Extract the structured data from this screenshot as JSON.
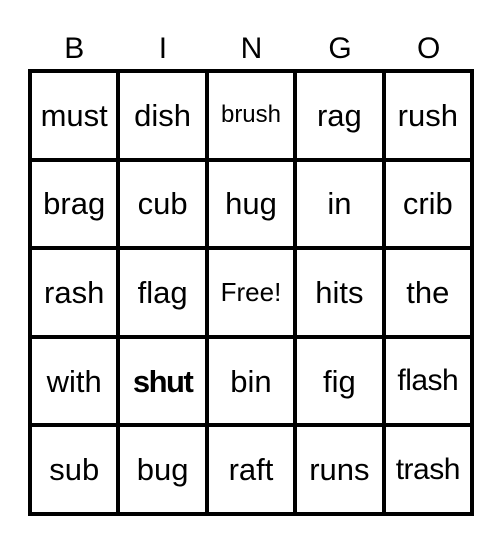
{
  "header": {
    "letters": [
      "B",
      "I",
      "N",
      "G",
      "O"
    ]
  },
  "board": {
    "rows": [
      [
        "must",
        "dish",
        "brush",
        "rag",
        "rush"
      ],
      [
        "brag",
        "cub",
        "hug",
        "in",
        "crib"
      ],
      [
        "rash",
        "flag",
        "Free!",
        "hits",
        "the"
      ],
      [
        "with",
        "shut",
        "bin",
        "fig",
        "flash"
      ],
      [
        "sub",
        "bug",
        "raft",
        "runs",
        "trash"
      ]
    ],
    "free_space": "Free!",
    "highlighted_word": "shut"
  },
  "colors": {
    "background": "#ffffff",
    "lines": "#000000",
    "text": "#000000"
  }
}
